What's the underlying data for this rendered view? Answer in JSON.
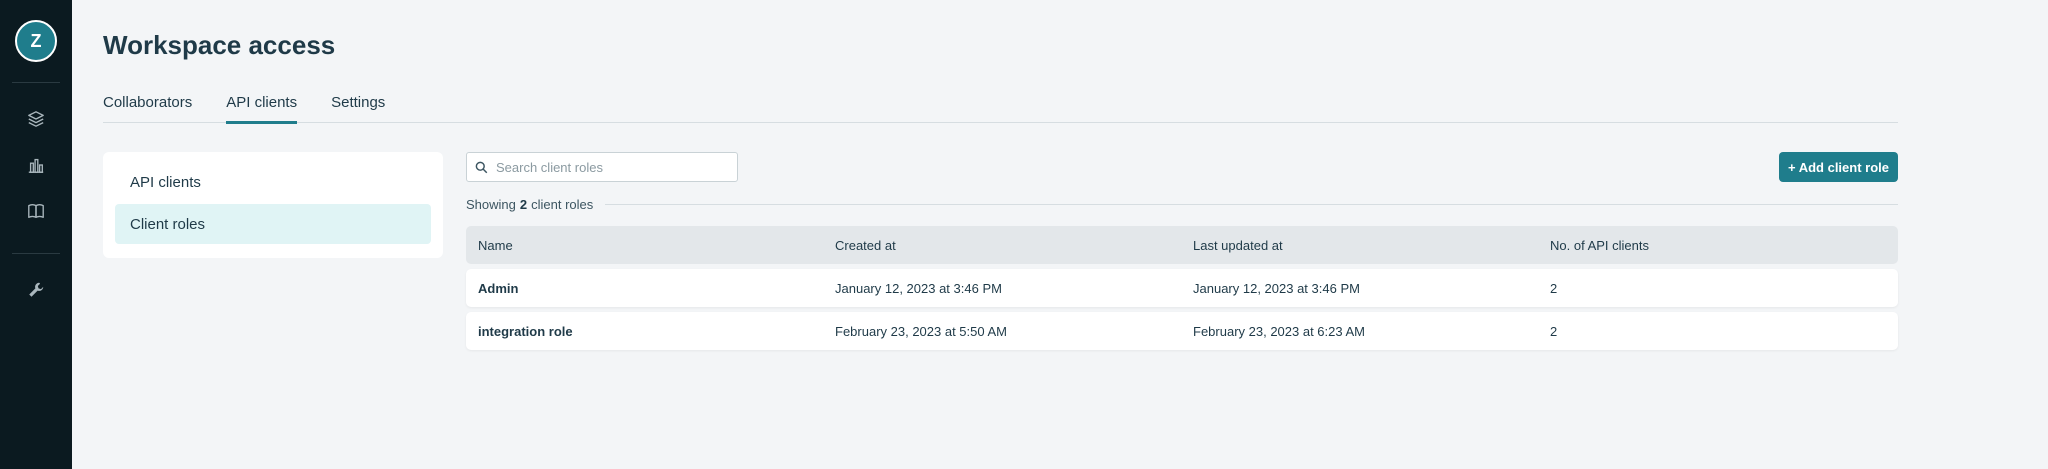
{
  "rail": {
    "avatar_letter": "Z",
    "icons": [
      "layers-icon",
      "bar-chart-icon",
      "book-icon"
    ],
    "tools_icon": "wrench-icon"
  },
  "page": {
    "title": "Workspace access"
  },
  "tabs": [
    {
      "label": "Collaborators",
      "active": false
    },
    {
      "label": "API clients",
      "active": true
    },
    {
      "label": "Settings",
      "active": false
    }
  ],
  "subnav": {
    "items": [
      {
        "label": "API clients",
        "active": false
      },
      {
        "label": "Client roles",
        "active": true
      }
    ]
  },
  "search": {
    "placeholder": "Search client roles",
    "value": ""
  },
  "add_button": {
    "label": "+ Add client role"
  },
  "summary": {
    "prefix": "Showing",
    "count": "2",
    "suffix": "client roles"
  },
  "table": {
    "columns": [
      "Name",
      "Created at",
      "Last updated at",
      "No. of API clients"
    ],
    "rows": [
      {
        "name": "Admin",
        "created": "January 12, 2023 at 3:46 PM",
        "updated": "January 12, 2023 at 3:46 PM",
        "clients": "2"
      },
      {
        "name": "integration role",
        "created": "February 23, 2023 at 5:50 AM",
        "updated": "February 23, 2023 at 6:23 AM",
        "clients": "2"
      }
    ]
  },
  "colors": {
    "accent": "#1f7d8c",
    "rail": "#0b1a20",
    "active_bg": "#e0f4f5"
  }
}
